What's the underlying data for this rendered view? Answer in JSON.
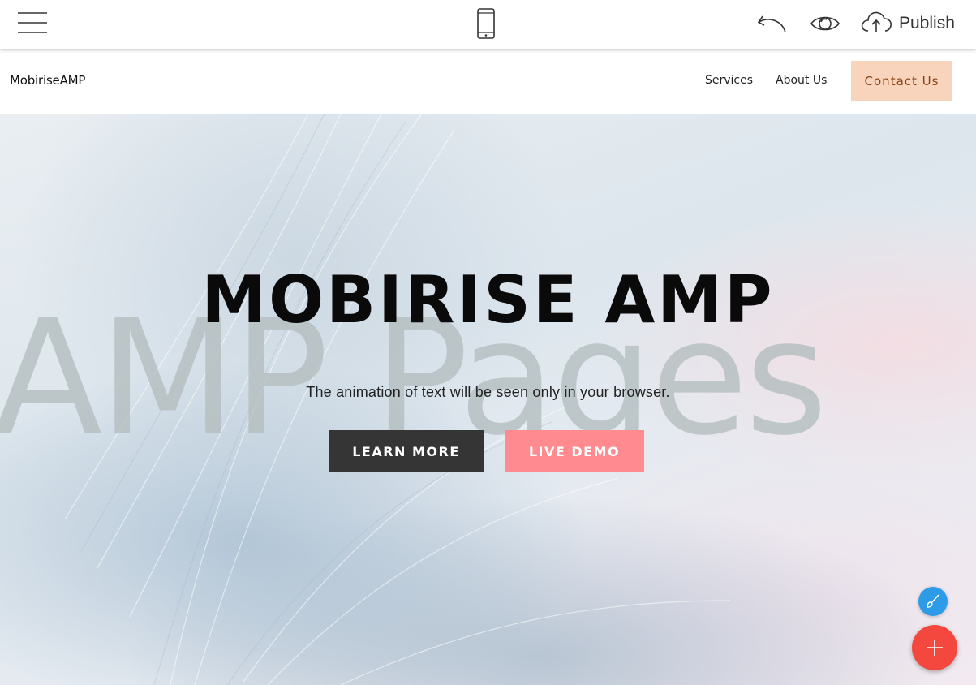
{
  "toolbar": {
    "menu_icon": "hamburger-icon",
    "device_icon": "mobile-phone-icon",
    "undo_icon": "undo-arrow-icon",
    "preview_icon": "eye-icon",
    "publish_icon": "cloud-upload-icon",
    "publish_label": "Publish"
  },
  "navbar": {
    "brand": "MobiriseAMP",
    "links": [
      {
        "label": "Services"
      },
      {
        "label": "About Us"
      }
    ],
    "contact_label": "Contact Us"
  },
  "hero": {
    "background_word": "AMP Pages",
    "title": "MOBIRISE AMP",
    "subtitle": "The animation of text will be seen only in your browser.",
    "primary_button": "LEARN MORE",
    "secondary_button": "LIVE DEMO"
  },
  "fab": {
    "brush_icon": "paint-brush-icon",
    "add_icon": "plus-icon"
  },
  "colors": {
    "contact_bg": "#f9d4bd",
    "contact_text": "#8a4314",
    "learn_more_bg": "#353535",
    "live_demo_bg": "#ff8a8f",
    "fab_brush": "#2d9be8",
    "fab_add": "#f4473d"
  }
}
